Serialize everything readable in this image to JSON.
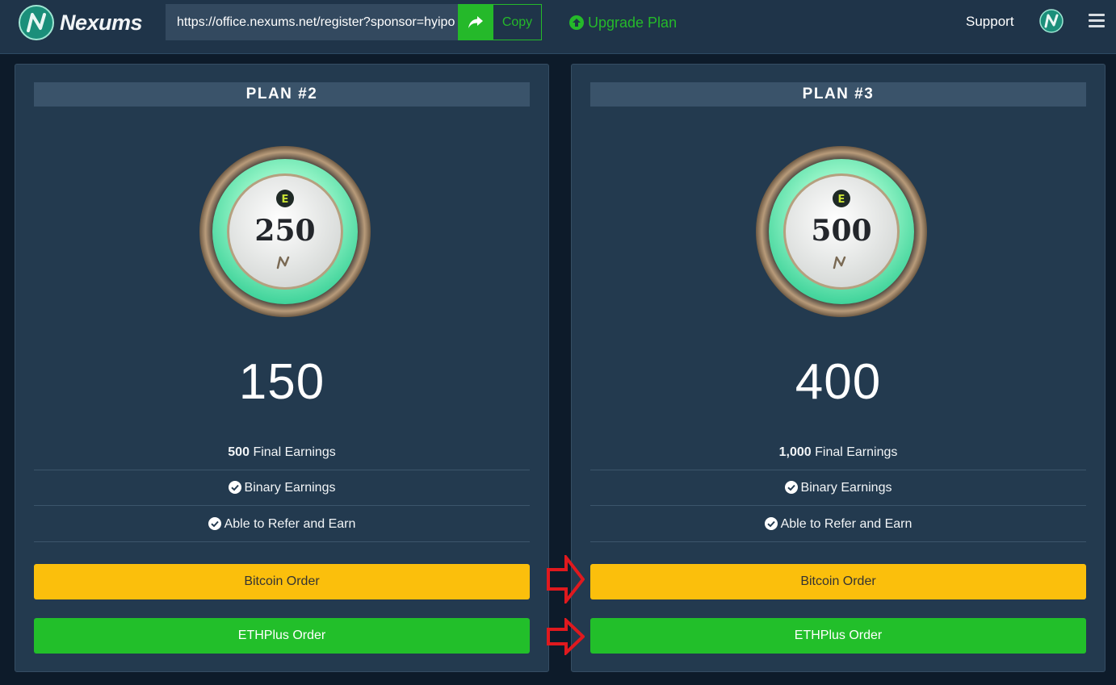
{
  "header": {
    "brand": "Nexums",
    "referral_url": "https://office.nexums.net/register?sponsor=hyipo",
    "copy_label": "Copy",
    "upgrade_label": "Upgrade Plan",
    "support_label": "Support",
    "accent_color": "#25b92a"
  },
  "plans": [
    {
      "title": "PLAN #2",
      "coin_value": "250",
      "coin_emblem": "E",
      "price": "150",
      "final_earnings_amount": "500",
      "final_earnings_label": "Final Earnings",
      "binary_label": "Binary Earnings",
      "refer_label": "Able to Refer and Earn",
      "bitcoin_button": "Bitcoin Order",
      "eth_button": "ETHPlus Order"
    },
    {
      "title": "PLAN #3",
      "coin_value": "500",
      "coin_emblem": "E",
      "price": "400",
      "final_earnings_amount": "1,000",
      "final_earnings_label": "Final Earnings",
      "binary_label": "Binary Earnings",
      "refer_label": "Able to Refer and Earn",
      "bitcoin_button": "Bitcoin Order",
      "eth_button": "ETHPlus Order"
    }
  ],
  "colors": {
    "bitcoin": "#fbbf0c",
    "eth": "#22bf2a",
    "annotation_arrow": "#e0191e"
  }
}
